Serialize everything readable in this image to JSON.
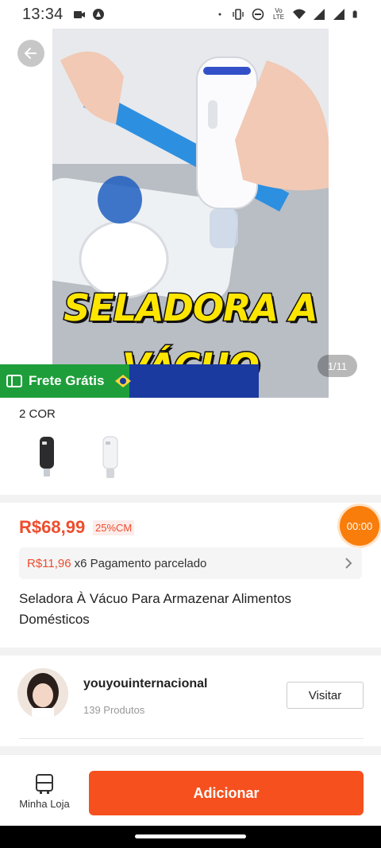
{
  "status_bar": {
    "time": "13:34",
    "left_icons": [
      "video-icon",
      "shield-icon"
    ],
    "right_icons": [
      "dot-icon",
      "vibrate-icon",
      "dnd-icon",
      "volte-icon",
      "wifi-icon",
      "signal-icon",
      "signal-icon",
      "battery-icon"
    ],
    "volte_text": "Vo LTE"
  },
  "gallery": {
    "overlay_line1": "SELADORA A",
    "overlay_line2": "VÁCUO",
    "pager": "1/11",
    "promo_label": "Frete Grátis"
  },
  "variants": {
    "title": "2 COR",
    "options": [
      "black-sealer",
      "white-sealer"
    ]
  },
  "price": {
    "value": "R$68,99",
    "discount": "25%CM",
    "timer": "00:00",
    "installment_amount": "R$11,96",
    "installment_text": "x6 Pagamento parcelado",
    "product_title": "Seladora À Vácuo Para Armazenar Alimentos Domésticos"
  },
  "seller": {
    "name": "youyouinternacional",
    "products": "139 Produtos",
    "visit_label": "Visitar"
  },
  "bottom_bar": {
    "shop_label": "Minha Loja",
    "add_label": "Adicionar"
  },
  "colors": {
    "accent": "#ee4d2d",
    "add_button": "#f5501e",
    "timer": "#f97d0a",
    "frete": "#1e9e3a"
  }
}
